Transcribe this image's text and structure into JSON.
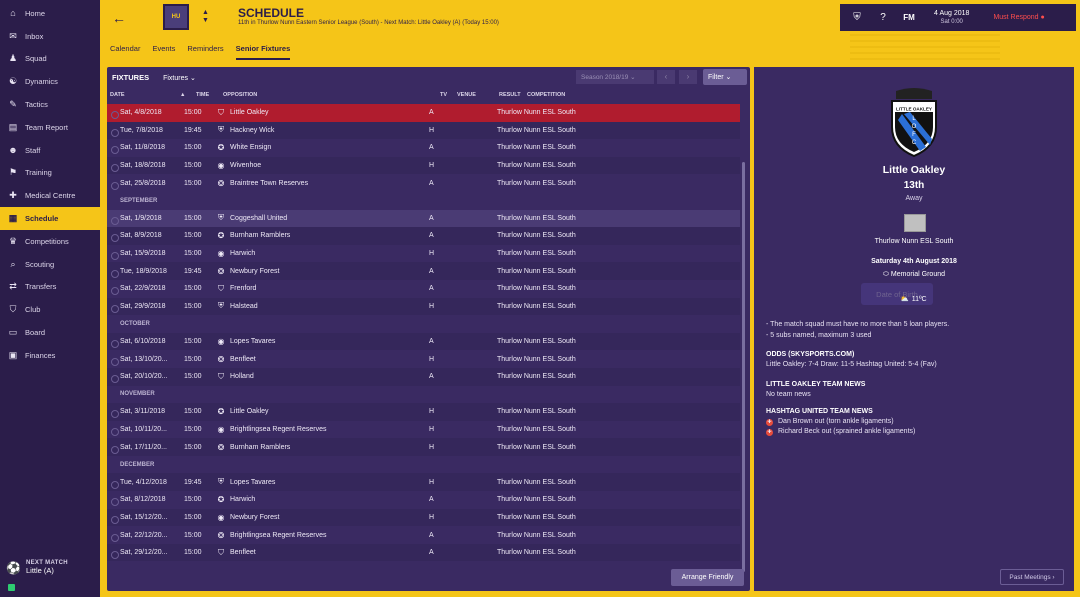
{
  "sidebar": {
    "items": [
      {
        "label": "Home",
        "icon": "home-icon",
        "glyph": "⌂"
      },
      {
        "label": "Inbox",
        "icon": "inbox-icon",
        "glyph": "✉"
      },
      {
        "label": "Squad",
        "icon": "squad-icon",
        "glyph": "♟"
      },
      {
        "label": "Dynamics",
        "icon": "dynamics-icon",
        "glyph": "☯"
      },
      {
        "label": "Tactics",
        "icon": "tactics-icon",
        "glyph": "✎"
      },
      {
        "label": "Team Report",
        "icon": "report-icon",
        "glyph": "▤"
      },
      {
        "label": "Staff",
        "icon": "staff-icon",
        "glyph": "☻"
      },
      {
        "label": "Training",
        "icon": "training-icon",
        "glyph": "⚑"
      },
      {
        "label": "Medical Centre",
        "icon": "medical-icon",
        "glyph": "✚"
      },
      {
        "label": "Schedule",
        "icon": "calendar-icon",
        "glyph": "▦"
      },
      {
        "label": "Competitions",
        "icon": "trophy-icon",
        "glyph": "♛"
      },
      {
        "label": "Scouting",
        "icon": "scouting-icon",
        "glyph": "⌕"
      },
      {
        "label": "Transfers",
        "icon": "transfers-icon",
        "glyph": "⇄"
      },
      {
        "label": "Club",
        "icon": "club-icon",
        "glyph": "⛉"
      },
      {
        "label": "Board",
        "icon": "board-icon",
        "glyph": "▭"
      },
      {
        "label": "Finances",
        "icon": "finances-icon",
        "glyph": "▣"
      }
    ],
    "active_index": 9,
    "next_match_label": "NEXT MATCH",
    "next_match_value": "Little (A)"
  },
  "header": {
    "title": "SCHEDULE",
    "subtitle": "11th in Thurlow Nunn Eastern Senior League (South) - Next Match: Little Oakley (A) (Today 15:00)",
    "crest_text": "HU",
    "tabs": [
      "Calendar",
      "Events",
      "Reminders",
      "Senior Fixtures"
    ],
    "active_tab": 3
  },
  "topbar": {
    "date": "4 Aug 2018",
    "time": "Sat 0:00",
    "fm": "FM",
    "continue": "Must Respond"
  },
  "fixtures": {
    "title": "FIXTURES",
    "view": "Fixtures",
    "season": "Season 2018/19",
    "filter": "Filter",
    "columns": {
      "date": "DATE",
      "time": "TIME",
      "opposition": "OPPOSITION",
      "tv": "TV",
      "venue": "VENUE",
      "result": "RESULT",
      "competition": "COMPETITION"
    },
    "arrange": "Arrange Friendly",
    "rows": [
      {
        "type": "row",
        "date": "Sat, 4/8/2018",
        "time": "15:00",
        "opp": "Little Oakley",
        "venue": "A",
        "comp": "Thurlow Nunn ESL South",
        "state": "sel"
      },
      {
        "type": "row",
        "date": "Tue, 7/8/2018",
        "time": "19:45",
        "opp": "Hackney Wick",
        "venue": "H",
        "comp": "Thurlow Nunn ESL South"
      },
      {
        "type": "row",
        "date": "Sat, 11/8/2018",
        "time": "15:00",
        "opp": "White Ensign",
        "venue": "A",
        "comp": "Thurlow Nunn ESL South"
      },
      {
        "type": "row",
        "date": "Sat, 18/8/2018",
        "time": "15:00",
        "opp": "Wivenhoe",
        "venue": "H",
        "comp": "Thurlow Nunn ESL South"
      },
      {
        "type": "row",
        "date": "Sat, 25/8/2018",
        "time": "15:00",
        "opp": "Braintree Town Reserves",
        "venue": "A",
        "comp": "Thurlow Nunn ESL South"
      },
      {
        "type": "sec",
        "label": "SEPTEMBER"
      },
      {
        "type": "row",
        "date": "Sat, 1/9/2018",
        "time": "15:00",
        "opp": "Coggeshall United",
        "venue": "A",
        "comp": "Thurlow Nunn ESL South",
        "state": "hl"
      },
      {
        "type": "row",
        "date": "Sat, 8/9/2018",
        "time": "15:00",
        "opp": "Burnham Ramblers",
        "venue": "A",
        "comp": "Thurlow Nunn ESL South"
      },
      {
        "type": "row",
        "date": "Sat, 15/9/2018",
        "time": "15:00",
        "opp": "Harwich",
        "venue": "H",
        "comp": "Thurlow Nunn ESL South"
      },
      {
        "type": "row",
        "date": "Tue, 18/9/2018",
        "time": "19:45",
        "opp": "Newbury Forest",
        "venue": "A",
        "comp": "Thurlow Nunn ESL South"
      },
      {
        "type": "row",
        "date": "Sat, 22/9/2018",
        "time": "15:00",
        "opp": "Frenford",
        "venue": "A",
        "comp": "Thurlow Nunn ESL South"
      },
      {
        "type": "row",
        "date": "Sat, 29/9/2018",
        "time": "15:00",
        "opp": "Halstead",
        "venue": "H",
        "comp": "Thurlow Nunn ESL South"
      },
      {
        "type": "sec",
        "label": "OCTOBER"
      },
      {
        "type": "row",
        "date": "Sat, 6/10/2018",
        "time": "15:00",
        "opp": "Lopes Tavares",
        "venue": "A",
        "comp": "Thurlow Nunn ESL South"
      },
      {
        "type": "row",
        "date": "Sat, 13/10/20...",
        "time": "15:00",
        "opp": "Benfleet",
        "venue": "H",
        "comp": "Thurlow Nunn ESL South"
      },
      {
        "type": "row",
        "date": "Sat, 20/10/20...",
        "time": "15:00",
        "opp": "Holland",
        "venue": "A",
        "comp": "Thurlow Nunn ESL South"
      },
      {
        "type": "sec",
        "label": "NOVEMBER"
      },
      {
        "type": "row",
        "date": "Sat, 3/11/2018",
        "time": "15:00",
        "opp": "Little Oakley",
        "venue": "H",
        "comp": "Thurlow Nunn ESL South"
      },
      {
        "type": "row",
        "date": "Sat, 10/11/20...",
        "time": "15:00",
        "opp": "Brightlingsea Regent Reserves",
        "venue": "H",
        "comp": "Thurlow Nunn ESL South"
      },
      {
        "type": "row",
        "date": "Sat, 17/11/20...",
        "time": "15:00",
        "opp": "Burnham Ramblers",
        "venue": "H",
        "comp": "Thurlow Nunn ESL South"
      },
      {
        "type": "sec",
        "label": "DECEMBER"
      },
      {
        "type": "row",
        "date": "Tue, 4/12/2018",
        "time": "19:45",
        "opp": "Lopes Tavares",
        "venue": "H",
        "comp": "Thurlow Nunn ESL South"
      },
      {
        "type": "row",
        "date": "Sat, 8/12/2018",
        "time": "15:00",
        "opp": "Harwich",
        "venue": "A",
        "comp": "Thurlow Nunn ESL South"
      },
      {
        "type": "row",
        "date": "Sat, 15/12/20...",
        "time": "15:00",
        "opp": "Newbury Forest",
        "venue": "H",
        "comp": "Thurlow Nunn ESL South"
      },
      {
        "type": "row",
        "date": "Sat, 22/12/20...",
        "time": "15:00",
        "opp": "Brightlingsea Regent Reserves",
        "venue": "A",
        "comp": "Thurlow Nunn ESL South"
      },
      {
        "type": "row",
        "date": "Sat, 29/12/20...",
        "time": "15:00",
        "opp": "Benfleet",
        "venue": "A",
        "comp": "Thurlow Nunn ESL South"
      }
    ]
  },
  "match": {
    "crest_text": "LITTLE OAKLEY",
    "crest_letters": [
      "L",
      "O",
      "F",
      "C"
    ],
    "opponent": "Little Oakley",
    "position": "13th",
    "venue": "Away",
    "league": "Thurlow Nunn ESL South",
    "date": "Saturday 4th August 2018",
    "ground": "Memorial Ground",
    "ghost_button": "Date of Birth",
    "temp": "11ºC",
    "rules": [
      "- The match squad must have no more than 5 loan players.",
      "- 5 subs named, maximum 3 used"
    ],
    "odds_title": "ODDS (SKYSPORTS.COM)",
    "odds_text": "Little Oakley: 7-4 Draw: 11-5 Hashtag United: 5-4 (Fav)",
    "opp_news_title": "LITTLE OAKLEY TEAM NEWS",
    "opp_news_text": "No team news",
    "our_news_title": "HASHTAG UNITED TEAM NEWS",
    "injuries": [
      "Dan Brown out (torn ankle ligaments)",
      "Richard Beck out (sprained ankle ligaments)"
    ],
    "past_meetings": "Past Meetings"
  }
}
